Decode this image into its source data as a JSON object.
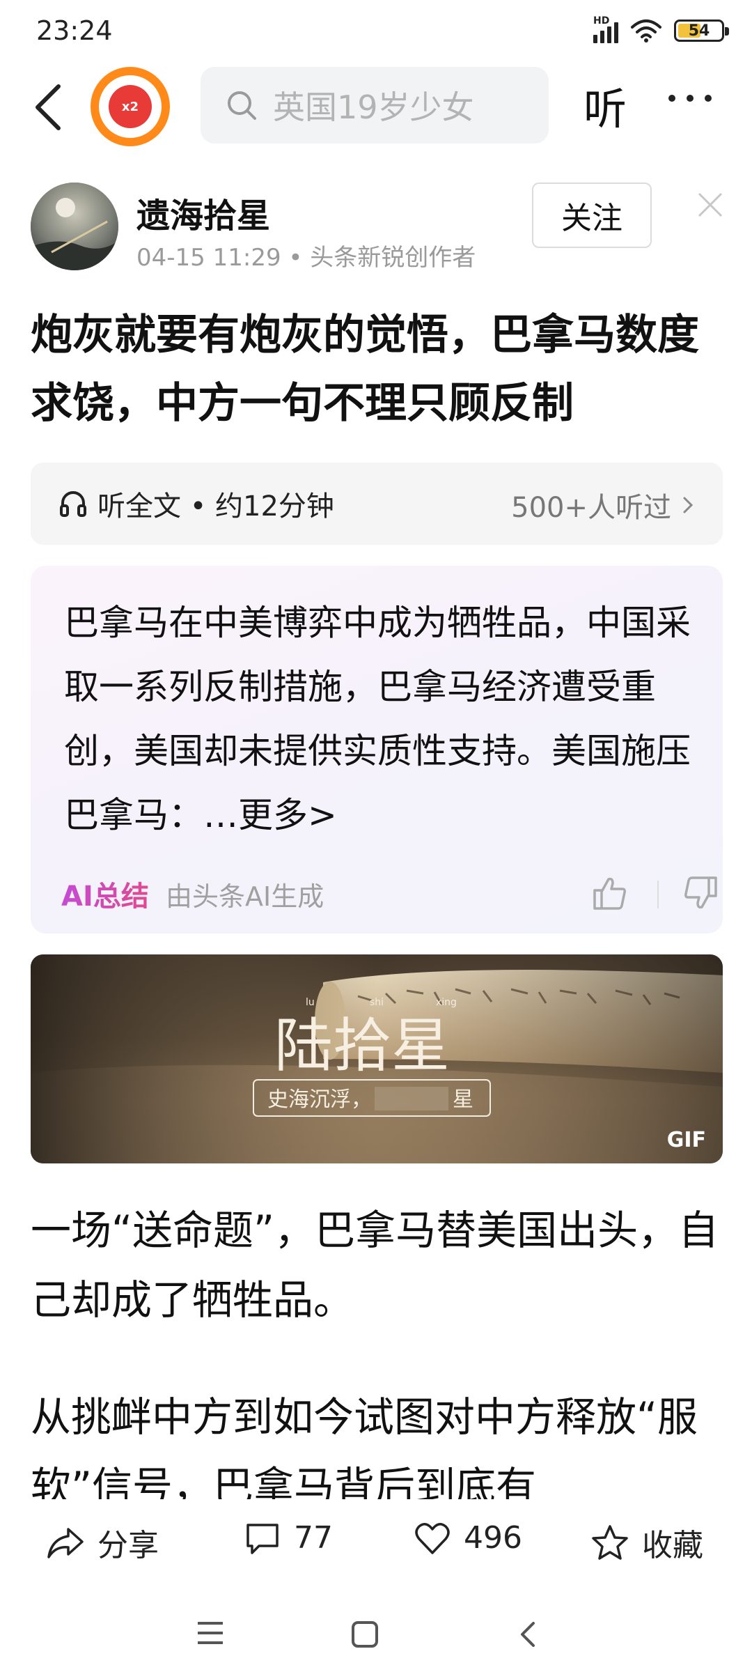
{
  "status_bar": {
    "time": "23:24",
    "network_label": "HD",
    "battery_level": "54",
    "battery_fraction": 0.54
  },
  "nav": {
    "reward_badge": "x2",
    "search_placeholder": "英国19岁少女",
    "listen_label": "听"
  },
  "author": {
    "name": "遗海拾星",
    "meta": "04-15 11:29 • 头条新锐创作者",
    "follow_label": "关注"
  },
  "article": {
    "title": "炮灰就要有炮灰的觉悟，巴拿马数度求饶，中方一句不理只顾反制"
  },
  "listen_bar": {
    "label": "听全文 • 约12分钟",
    "count": "500+人听过"
  },
  "ai_summary": {
    "text": "巴拿马在中美博弈中成为牺牲品，中国采取一系列反制措施，巴拿马经济遭受重创，美国却未提供实质性支持。美国施压巴拿马：",
    "more_label": "…更多>",
    "label": "AI总结",
    "source": "由头条AI生成"
  },
  "banner": {
    "gif_label": "GIF",
    "pinyin": [
      "lu",
      "shi",
      "xing"
    ],
    "title": "陆拾星",
    "subtitle": "史海沉浮，",
    "subtitle_end": "星"
  },
  "body": {
    "paragraph_1": "一场“送命题”，巴拿马替美国出头，自己却成了牺牲品。",
    "paragraph_2": "从挑衅中方到如今试图对中方释放“服软”信号，巴拿马背后到底有"
  },
  "actions": {
    "share_label": "分享",
    "comment_count": "77",
    "like_count": "496",
    "favorite_label": "收藏"
  },
  "colors": {
    "accent_orange": "#ff8a1a",
    "reward_red": "#e83a36",
    "ai_gradient_start": "#c34bd4",
    "ai_gradient_end": "#e04a8f"
  }
}
